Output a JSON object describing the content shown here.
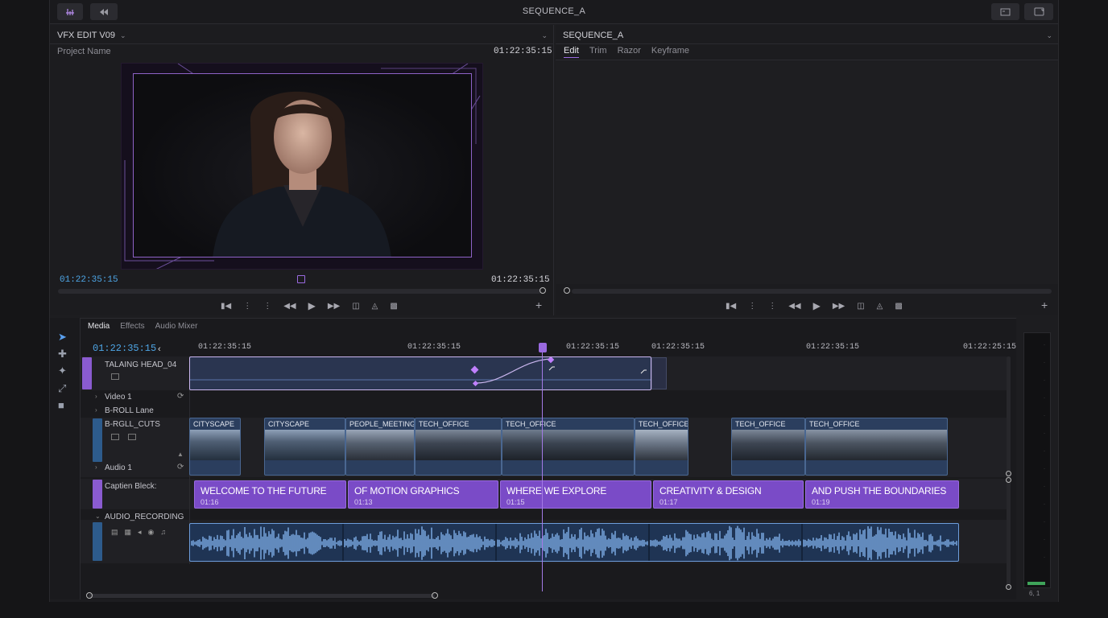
{
  "window": {
    "title": "SEQUENCE_A"
  },
  "source_panel": {
    "title": "VFX EDIT V09",
    "project_label": "Project Name",
    "timecode_top": "01:22:35:15",
    "timecode_in": "01:22:35:15",
    "timecode_out": "01:22:35:15"
  },
  "program_panel": {
    "title": "SEQUENCE_A",
    "tabs": [
      "Edit",
      "Trim",
      "Razor",
      "Keyframe"
    ]
  },
  "timeline": {
    "tabs": [
      "Media",
      "Effects",
      "Audio Mixer"
    ],
    "current_timecode": "01:22:35:15",
    "ruler": [
      "01:22:35:15",
      "01:22:35:15",
      "01:22:35:15",
      "01:22:35:15",
      "01:22:35:15",
      "01:22:25:15"
    ],
    "tracks": {
      "talking_head": "TALAING HEAD_04",
      "video1": "Video 1",
      "broll_lane": "B-ROLL Lane",
      "broll_cuts": "B-RGLL_CUTS",
      "audio1": "Audio 1",
      "caption": "Captien Bleck:",
      "audio_rec": "AUDIO_RECORDING"
    },
    "broll_clips": [
      {
        "name": "CITYSCAPE"
      },
      {
        "name": "CITYSCAPE"
      },
      {
        "name": "PEOPLE_MEETING"
      },
      {
        "name": "TECH_OFFICE"
      },
      {
        "name": "TECH_OFFICE"
      },
      {
        "name": "TECH_OFFICE"
      },
      {
        "name": "TECH_OFFICE"
      },
      {
        "name": "TECH_OFFICE"
      }
    ],
    "captions": [
      {
        "text": "WELCOME TO THE FUTURE",
        "dur": "01:16"
      },
      {
        "text": "OF MOTION GRAPHICS",
        "dur": "01:13"
      },
      {
        "text": "WHERE WE EXPLORE",
        "dur": "01:15"
      },
      {
        "text": "CREATIVITY & DESIGN",
        "dur": "01:17"
      },
      {
        "text": "AND PUSH THE BOUNDARIES",
        "dur": "01:19"
      }
    ],
    "meter_label": "6, 1"
  },
  "colors": {
    "accent": "#9a6ae0",
    "timecode_blue": "#4ea6e6",
    "clip_blue": "#2b3e5e"
  }
}
